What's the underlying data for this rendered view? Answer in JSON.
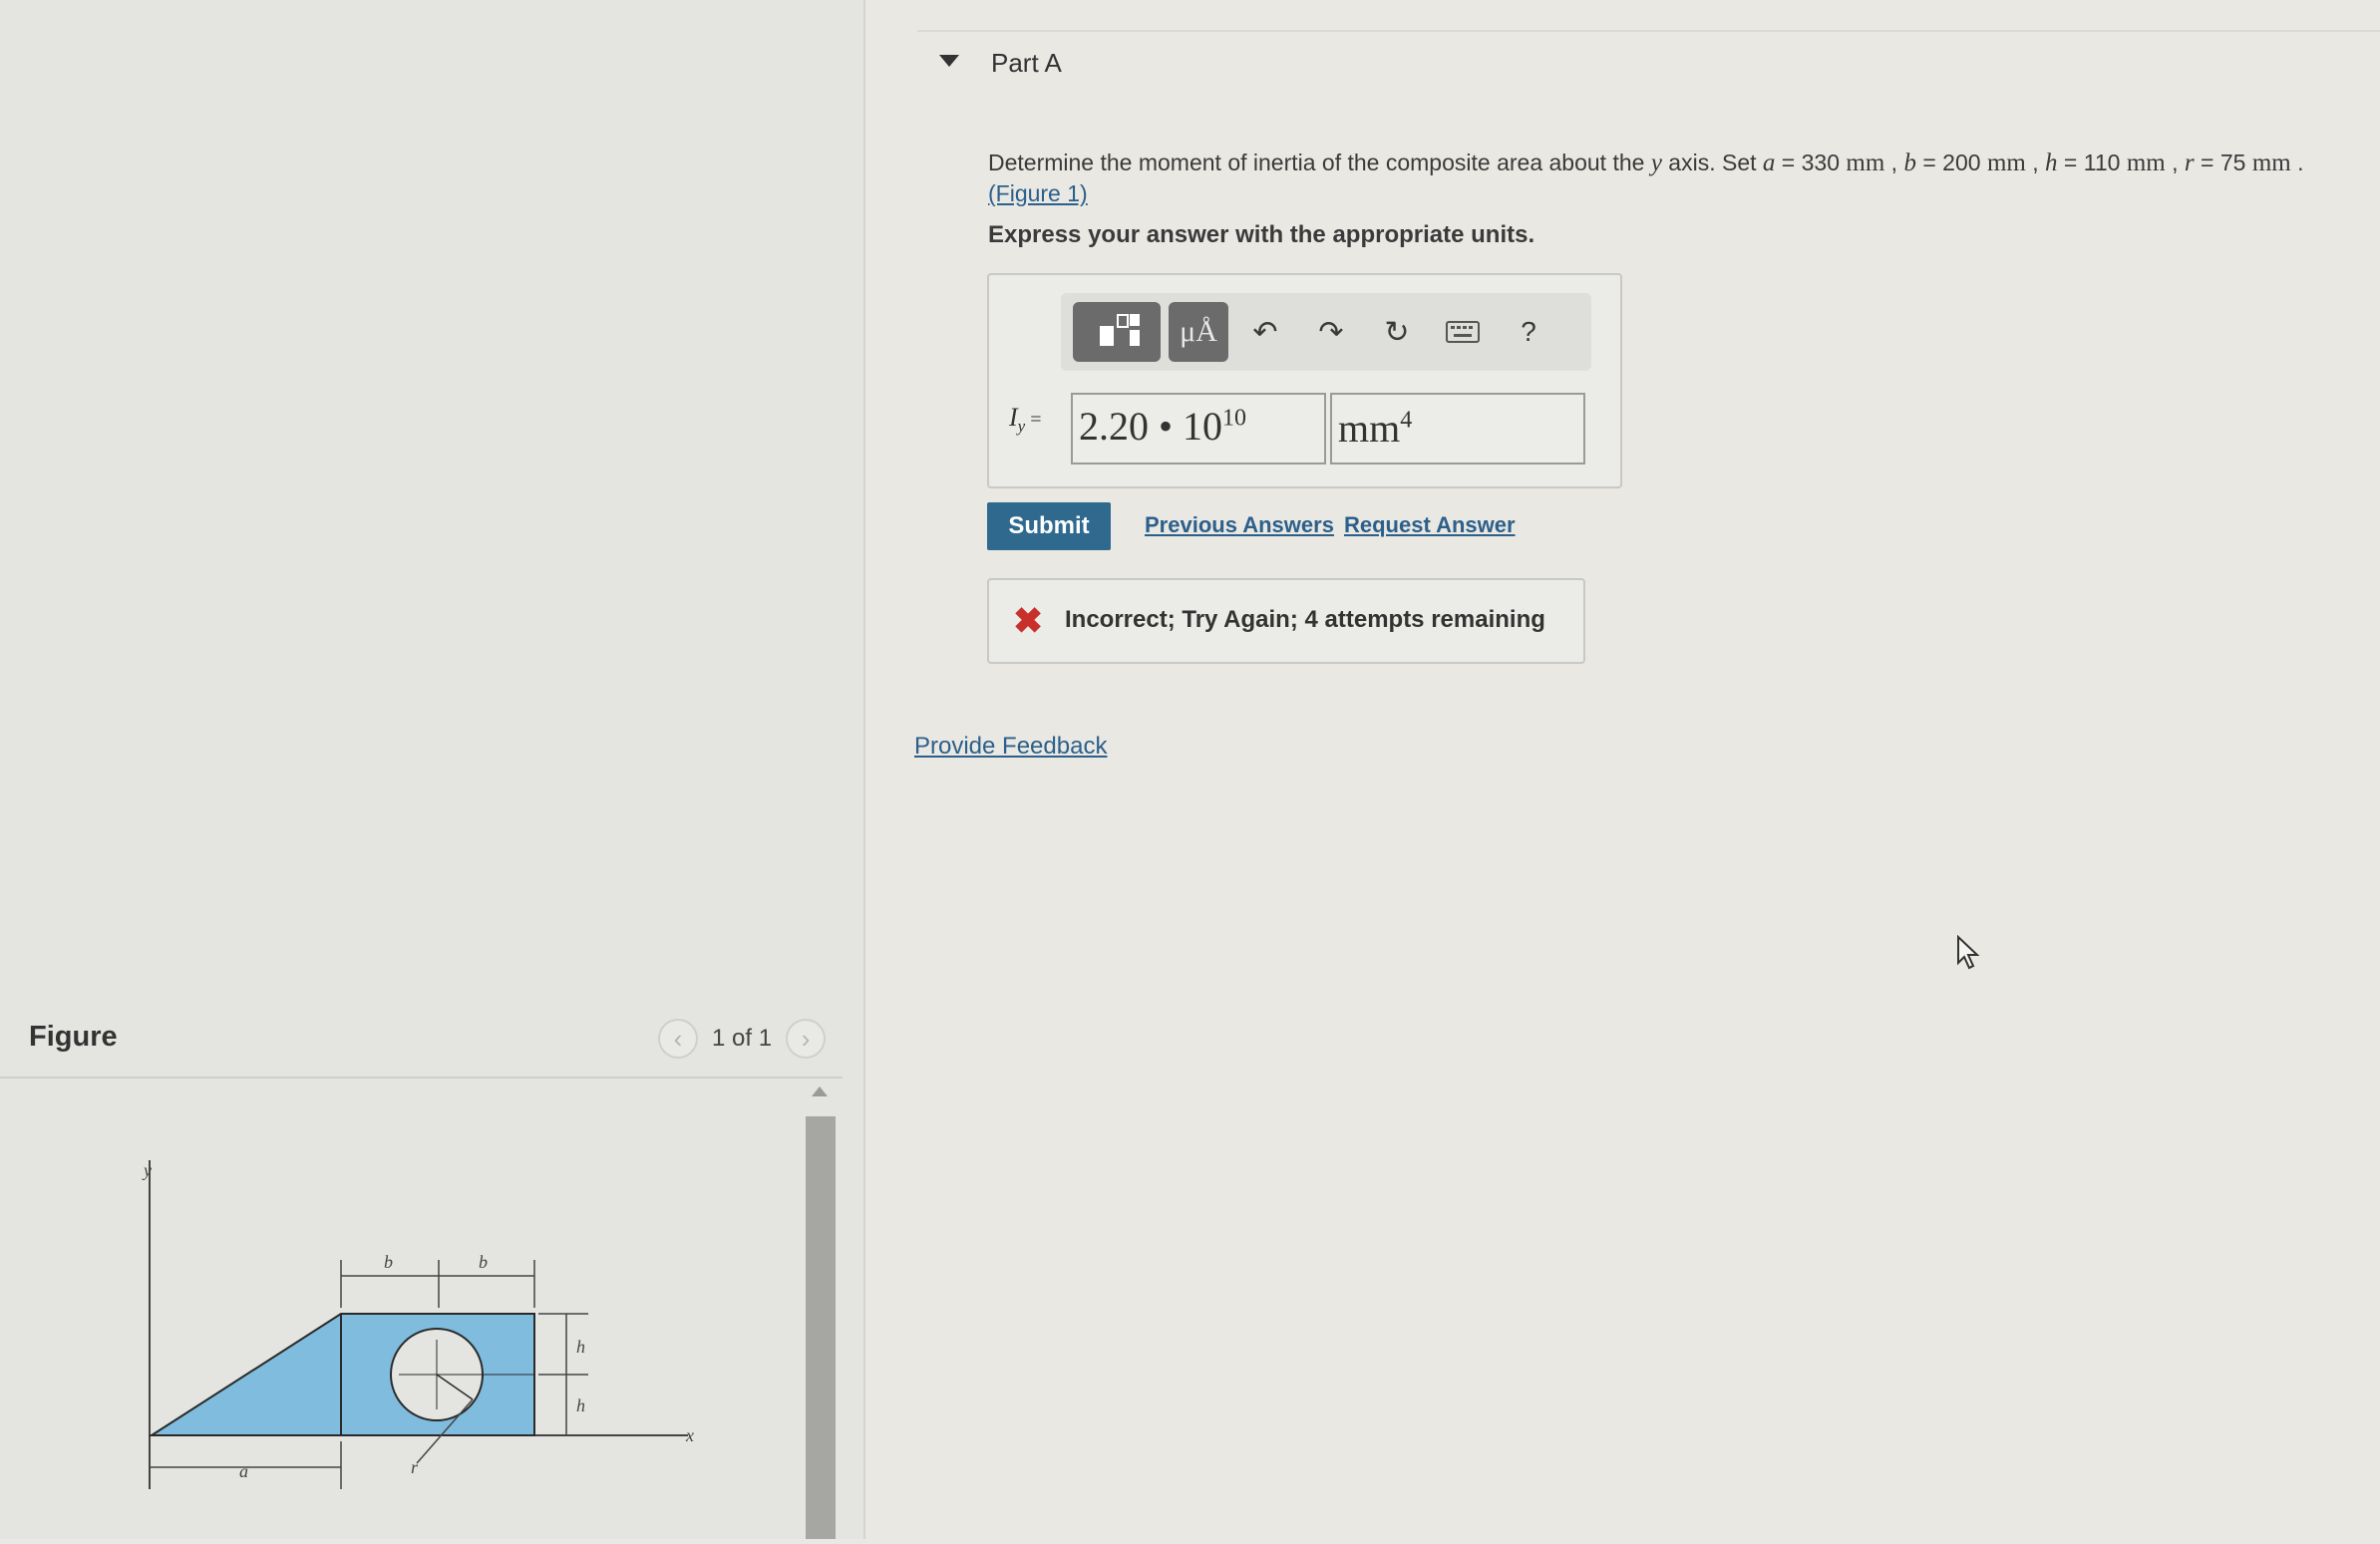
{
  "figure_panel": {
    "title": "Figure",
    "pager_text": "1 of 1",
    "prev_icon": "chevron-left-icon",
    "next_icon": "chevron-right-icon",
    "diagram_labels": {
      "y_axis": "y",
      "x_axis": "x",
      "b_left": "b",
      "b_right": "b",
      "h_top": "h",
      "h_bottom": "h",
      "a": "a",
      "r": "r"
    }
  },
  "part": {
    "title": "Part A",
    "question_prefix": "Determine the moment of inertia of the composite area about the ",
    "question_axis": "y",
    "question_mid": " axis. Set ",
    "a_var": "a",
    "a_val": " = 330 ",
    "b_var": "b",
    "b_val": " = 200 ",
    "h_var": "h",
    "h_val": " = 110 ",
    "r_var": "r",
    "r_val": " = 75 ",
    "unit": "mm",
    "sep": " , ",
    "end": " .",
    "figure_link": "(Figure 1)",
    "instruction": "Express your answer with the appropriate units."
  },
  "toolbar": {
    "units_label": "μÅ",
    "help_label": "?"
  },
  "answer": {
    "label_main": "I",
    "label_sub": "y",
    "label_eq": " =",
    "value_mantissa": "2.20 • 10",
    "value_exponent": "10",
    "unit_base": "mm",
    "unit_exponent": "4"
  },
  "actions": {
    "submit": "Submit",
    "previous_answers": "Previous Answers",
    "request_answer": "Request Answer"
  },
  "feedback": {
    "icon": "✖",
    "message": "Incorrect; Try Again; 4 attempts remaining"
  },
  "provide_feedback": "Provide Feedback",
  "colors": {
    "accent": "#2f6a8e",
    "link": "#2c5f8a",
    "error": "#c9302c",
    "shape_fill": "#7fbcde"
  }
}
